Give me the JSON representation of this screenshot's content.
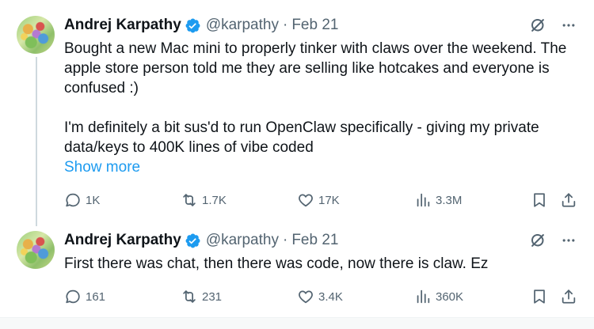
{
  "tweets": [
    {
      "author_name": "Andrej Karpathy",
      "handle": "@karpathy",
      "separator": "·",
      "date": "Feb 21",
      "text_p1": "Bought a new Mac mini to properly tinker with claws over the weekend. The apple store person told me they are selling like hotcakes and everyone is confused :)",
      "text_p2": "I'm definitely a bit sus'd to run OpenClaw specifically - giving my private data/keys to 400K lines of vibe coded",
      "show_more": "Show more",
      "replies": "1K",
      "reposts": "1.7K",
      "likes": "17K",
      "views": "3.3M"
    },
    {
      "author_name": "Andrej Karpathy",
      "handle": "@karpathy",
      "separator": "·",
      "date": "Feb 21",
      "text_p1": "First there was chat, then there was code, now there is claw. Ez",
      "replies": "161",
      "reposts": "231",
      "likes": "3.4K",
      "views": "360K"
    }
  ],
  "icons": {
    "verified": "verified-badge-icon",
    "grok": "grok-icon",
    "more": "more-icon",
    "reply": "reply-icon",
    "repost": "repost-icon",
    "like": "like-icon",
    "views": "views-icon",
    "bookmark": "bookmark-icon",
    "share": "share-icon"
  },
  "colors": {
    "text": "#0f1419",
    "secondary": "#536471",
    "link": "#1d9bf0",
    "verified": "#1d9bf0",
    "divider": "#eff3f4"
  }
}
